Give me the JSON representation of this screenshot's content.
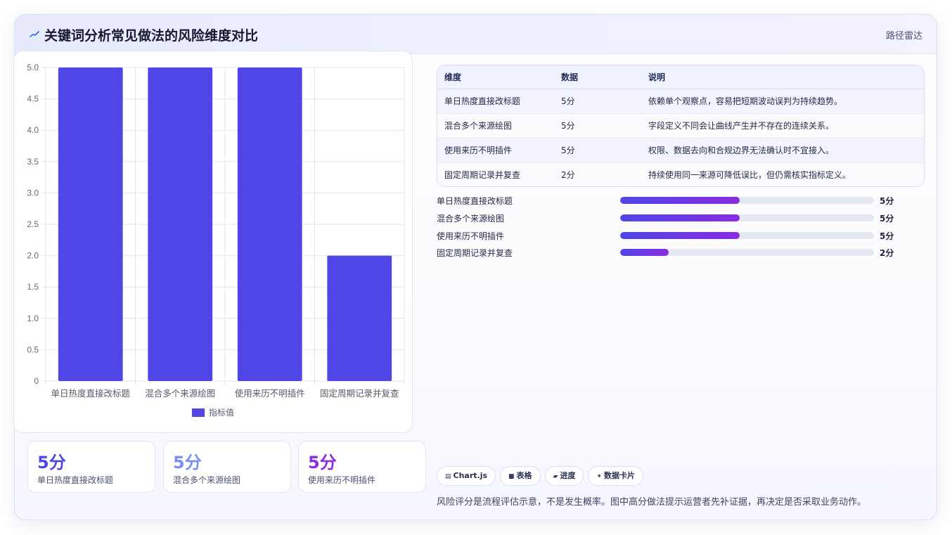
{
  "header": {
    "title": "关键词分析常见做法的风险维度对比",
    "tag": "路径雷达"
  },
  "colors": {
    "bar": "#4f46e5",
    "accent_start": "#4f46e5",
    "accent_end": "#8a2be2",
    "stat_colors": [
      "#4f46e5",
      "#7b8ff0",
      "#8a2be2"
    ]
  },
  "chart_data": {
    "type": "bar",
    "categories": [
      "单日热度直接改标题",
      "混合多个来源绘图",
      "使用来历不明插件",
      "固定周期记录并复查"
    ],
    "series": [
      {
        "name": "指标值",
        "values": [
          5,
          5,
          5,
          2
        ]
      }
    ],
    "ylim": [
      0,
      5
    ],
    "yticks": [
      "0",
      "0.5",
      "1.0",
      "1.5",
      "2.0",
      "2.5",
      "3.0",
      "3.5",
      "4.0",
      "4.5",
      "5.0"
    ],
    "grid": true,
    "legend": "bottom"
  },
  "stats": [
    {
      "value": "5分",
      "label": "单日热度直接改标题"
    },
    {
      "value": "5分",
      "label": "混合多个来源绘图"
    },
    {
      "value": "5分",
      "label": "使用来历不明插件"
    }
  ],
  "table": {
    "headers": [
      "维度",
      "数据",
      "说明"
    ],
    "rows": [
      [
        "单日热度直接改标题",
        "5分",
        "依赖单个观察点，容易把短期波动误判为持续趋势。"
      ],
      [
        "混合多个来源绘图",
        "5分",
        "字段定义不同会让曲线产生并不存在的连续关系。"
      ],
      [
        "使用来历不明插件",
        "5分",
        "权限、数据去向和合规边界无法确认时不宜接入。"
      ],
      [
        "固定周期记录并复查",
        "2分",
        "持续使用同一来源可降低误比，但仍需核实指标定义。"
      ]
    ]
  },
  "progress": [
    {
      "label": "单日热度直接改标题",
      "value": "5分",
      "fraction": 0.47
    },
    {
      "label": "混合多个来源绘图",
      "value": "5分",
      "fraction": 0.47
    },
    {
      "label": "使用来历不明插件",
      "value": "5分",
      "fraction": 0.47
    },
    {
      "label": "固定周期记录并复查",
      "value": "2分",
      "fraction": 0.19
    }
  ],
  "chips": [
    {
      "icon": "▤",
      "label": "Chart.js"
    },
    {
      "icon": "■",
      "label": "表格"
    },
    {
      "icon": "▰",
      "label": "进度"
    },
    {
      "icon": "✦",
      "label": "数据卡片"
    }
  ],
  "footnote": "风险评分是流程评估示意，不是发生概率。图中高分做法提示运营者先补证据，再决定是否采取业务动作。"
}
